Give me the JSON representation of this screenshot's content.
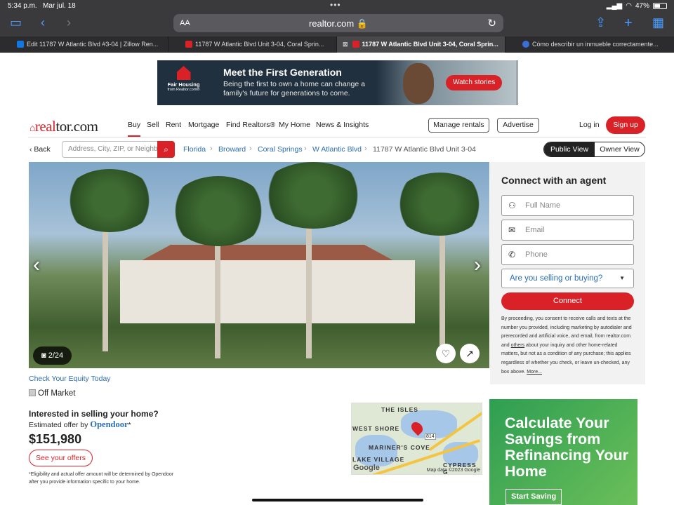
{
  "status_bar": {
    "time": "5:34 p.m.",
    "date": "Mar jul. 18",
    "battery": "47%"
  },
  "browser": {
    "aa_label": "AA",
    "url": "realtor.com 🔒",
    "tabs": [
      {
        "label": "Edit 11787 W Atlantic Blvd #3-04 | Zillow Ren..."
      },
      {
        "label": "11787 W Atlantic Blvd Unit 3-04, Coral Sprin..."
      },
      {
        "label": "11787 W Atlantic Blvd Unit 3-04, Coral Sprin..."
      },
      {
        "label": "Cómo describir un inmueble correctamente..."
      }
    ]
  },
  "ad": {
    "logo_line1": "Fair Housing",
    "logo_line2": "from Realtor.com®",
    "title": "Meet the First Generation",
    "body": "Being the first to own a home can change a family's future for generations to come.",
    "button": "Watch stories"
  },
  "nav": {
    "logo_a": "real",
    "logo_b": "tor.com",
    "items": [
      "Buy",
      "Sell",
      "Rent",
      "Mortgage",
      "Find Realtors®",
      "My Home",
      "News & Insights"
    ],
    "manage_rentals": "Manage rentals",
    "advertise": "Advertise",
    "login": "Log in",
    "signup": "Sign up"
  },
  "breadcrumb": {
    "back": "Back",
    "search_placeholder": "Address, City, ZIP, or Neighborhood",
    "items": [
      "Florida",
      "Broward",
      "Coral Springs",
      "W Atlantic Blvd",
      "11787 W Atlantic Blvd Unit 3-04"
    ],
    "public_view": "Public View",
    "owner_view": "Owner View"
  },
  "photo": {
    "counter": "2/24"
  },
  "agent_form": {
    "title": "Connect with an agent",
    "full_name": "Full Name",
    "email": "Email",
    "phone": "Phone",
    "select": "Are you selling or buying?",
    "connect": "Connect",
    "disclaimer_a": "By proceeding, you consent to receive calls and texts at the number you provided, including marketing by autodialer and prerecorded and artificial voice, and email, from realtor.com and ",
    "disclaimer_others": "others",
    "disclaimer_b": " about your inquiry and other home-related matters, but not as a condition of any purchase; this applies regardless of whether you check, or leave un-checked, any box above. ",
    "more": "More..."
  },
  "listing": {
    "equity_link": "Check Your Equity Today",
    "status": "Off Market",
    "question": "Interested in selling your home?",
    "estimated_by": "Estimated offer by",
    "opendoor": "Opendoor",
    "opendoor_mark": "*",
    "price": "$151,980",
    "offers_button": "See your offers",
    "fine_print": "*Eligibility and actual offer amount will be determined by Opendoor after you provide information specific to your home."
  },
  "map": {
    "labels": [
      "THE ISLES",
      "WEST SHORE",
      "MARINER'S COVE",
      "LAKE VILLAGE",
      "CYPRESS G"
    ],
    "shield": "814",
    "google": "Google",
    "attribution": "Map data ©2023 Google"
  },
  "promo": {
    "title": "Calculate Your Savings from Refinancing Your Home",
    "button": "Start Saving"
  }
}
